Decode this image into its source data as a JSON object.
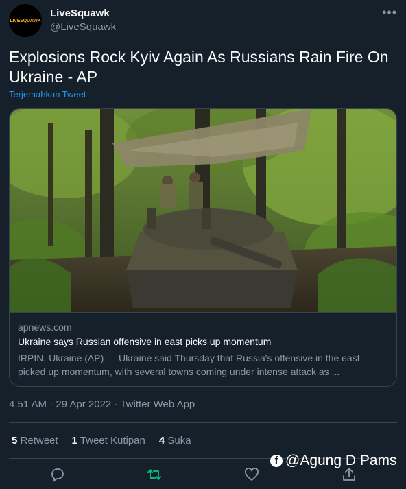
{
  "account": {
    "avatar_label": "LIVESQUAWK",
    "name": "LiveSquawk",
    "handle": "@LiveSquawk"
  },
  "more_icon": "more-icon",
  "tweet": {
    "text": "Explosions Rock Kyiv Again As Russians Rain Fire On Ukraine - AP",
    "translate_label": "Terjemahkan Tweet"
  },
  "card": {
    "image_alt": "tank-photo",
    "domain": "apnews.com",
    "title": "Ukraine says Russian offensive in east picks up momentum",
    "description": "IRPIN, Ukraine (AP) — Ukraine said Thursday that Russia's offensive in the east picked up momentum, with several towns coming under intense attack as ..."
  },
  "meta": {
    "timestamp": "4.51 AM · 29 Apr 2022 · Twitter Web App"
  },
  "stats": {
    "retweets_count": "5",
    "retweets_label": "Retweet",
    "quotes_count": "1",
    "quotes_label": "Tweet Kutipan",
    "likes_count": "4",
    "likes_label": "Suka"
  },
  "actions": [
    "reply-icon",
    "retweet-icon",
    "like-icon",
    "share-icon"
  ],
  "colors": {
    "background": "#15202b",
    "text": "#f7f9f9",
    "secondary": "#8b98a5",
    "link": "#1d9bf0",
    "retweet_active": "#00ba7c",
    "border": "#38444d"
  },
  "watermark": {
    "icon": "facebook-icon",
    "text": "@Agung D Pams"
  }
}
